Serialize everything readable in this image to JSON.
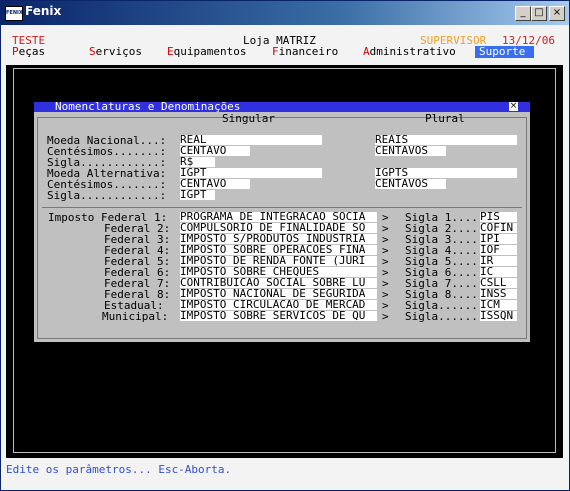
{
  "window": {
    "title": "Fenix",
    "icon_label": "FENIX",
    "controls": {
      "minimize": "_",
      "maximize": "□",
      "close": "×"
    }
  },
  "topbar": {
    "left": "TESTE",
    "center": "Loja MATRIZ",
    "user": "SUPERVISOR",
    "date": "13/12/06"
  },
  "menu": [
    {
      "hotkey": "P",
      "rest": "eças"
    },
    {
      "hotkey": "S",
      "rest": "erviços"
    },
    {
      "hotkey": "E",
      "rest": "quipamentos"
    },
    {
      "hotkey": "F",
      "rest": "inanceiro"
    },
    {
      "hotkey": "A",
      "rest": "dministrativo"
    },
    {
      "label": "Suporte"
    }
  ],
  "dialog": {
    "title": "Nomenclaturas e Denominações",
    "close": "×",
    "col_singular": "Singular",
    "col_plural": "Plural",
    "currency_rows": [
      {
        "label": "Moeda Nacional...:",
        "singular": "REAL",
        "plural": "REAIS"
      },
      {
        "label": "Centésimos.......:",
        "singular": "CENTAVO",
        "plural": "CENTAVOS"
      },
      {
        "label": "Sigla............:",
        "singular": "R$",
        "plural": ""
      },
      {
        "label": "Moeda Alternativa:",
        "singular": "IGPT",
        "plural": "IGPTS"
      },
      {
        "label": "Centésimos.......:",
        "singular": "CENTAVO",
        "plural": "CENTAVOS"
      },
      {
        "label": "Sigla............:",
        "singular": "IGPT",
        "plural": ""
      }
    ],
    "taxes": [
      {
        "label": "Imposto Federal 1:",
        "name": "PROGRAMA DE INTEGRACAO SOCIA",
        "arrow": ">",
        "sigla_label": "Sigla 1....",
        "sigla": "PIS"
      },
      {
        "label": "Federal 2:",
        "name": "COMPULSORIO DE FINALIDADE SO",
        "arrow": ">",
        "sigla_label": "Sigla 2....",
        "sigla": "COFIN"
      },
      {
        "label": "Federal 3:",
        "name": "IMPOSTO S/PRODUTOS INDUSTRIA",
        "arrow": ">",
        "sigla_label": "Sigla 3....",
        "sigla": "IPI"
      },
      {
        "label": "Federal 4:",
        "name": "IMPOSTO SOBRE OPERACOES FINA",
        "arrow": ">",
        "sigla_label": "Sigla 4....",
        "sigla": "IOF"
      },
      {
        "label": "Federal 5:",
        "name": "IMPOSTO DE RENDA FONTE (JURI",
        "arrow": ">",
        "sigla_label": "Sigla 5....",
        "sigla": "IR"
      },
      {
        "label": "Federal 6:",
        "name": "IMPOSTO SOBRE CHEQUES",
        "arrow": ">",
        "sigla_label": "Sigla 6....",
        "sigla": "IC"
      },
      {
        "label": "Federal 7:",
        "name": "CONTRIBUICAO SOCIAL SOBRE LU",
        "arrow": ">",
        "sigla_label": "Sigla 7....",
        "sigla": "CSLL"
      },
      {
        "label": "Federal 8:",
        "name": "IMPOSTO NACIONAL DE SEGURIDA",
        "arrow": ">",
        "sigla_label": "Sigla 8....",
        "sigla": "INSS"
      },
      {
        "label": "Estadual:",
        "name": "IMPOSTO CIRCULACAO DE MERCAD",
        "arrow": ">",
        "sigla_label": "Sigla......",
        "sigla": "ICM"
      },
      {
        "label": "Municipal:",
        "name": "IMPOSTO SOBRE SERVICOS DE QU",
        "arrow": ">",
        "sigla_label": "Sigla......",
        "sigla": "ISSQN"
      }
    ]
  },
  "status": "Edite os parâmetros... Esc-Aborta.",
  "colors": {
    "titlebar_start": "#0a246a",
    "menu_hotkey": "#e00000",
    "active_menu": "#3a6ef0",
    "supervisor": "#f0a020",
    "date": "#d02020",
    "dialog_title": "#3030e0",
    "status_text": "#3050d0"
  }
}
